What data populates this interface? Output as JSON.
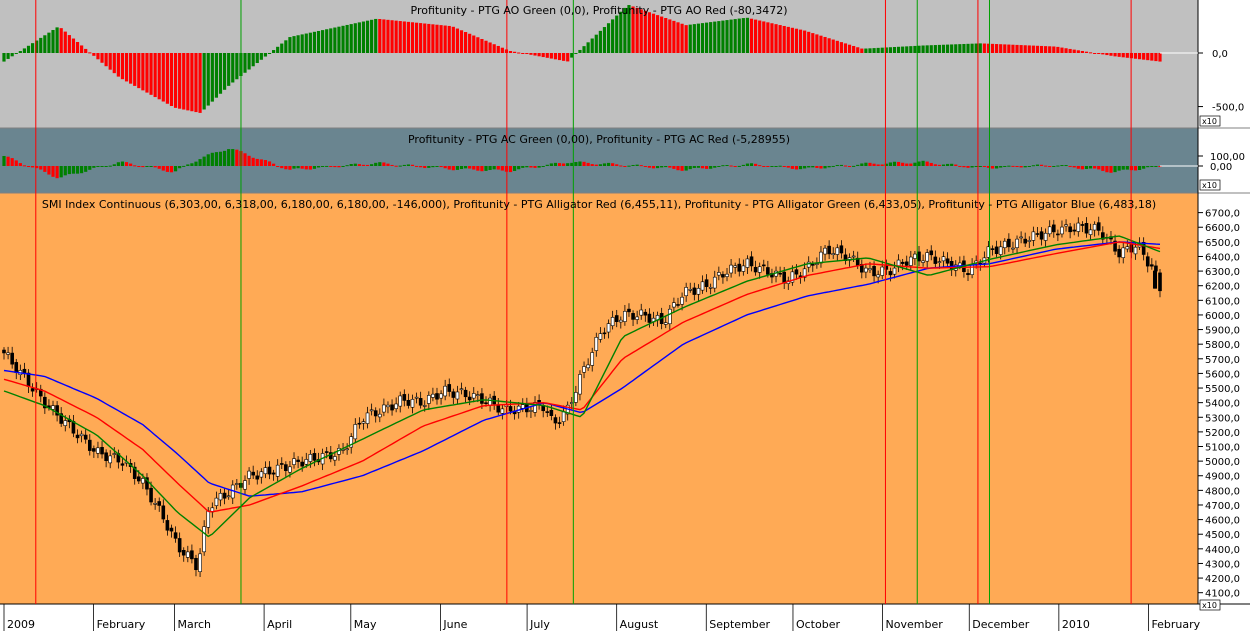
{
  "panels": {
    "ao": {
      "title": "Profitunity - PTG AO Green (0,0), Profitunity - PTG AO Red (-80,3472)",
      "ticks": [
        "0,0",
        "-500,0"
      ],
      "badge": "x10",
      "colors": {
        "background": "#c0c0c0",
        "up": "#008000",
        "down": "#ff0000"
      }
    },
    "ac": {
      "title": "Profitunity - PTG AC Green (0,00), Profitunity - PTG AC Red (-5,28955)",
      "ticks": [
        "100,00",
        "0,00"
      ],
      "badge": "x10",
      "colors": {
        "background": "#6a8590",
        "up": "#008000",
        "down": "#ff0000"
      }
    },
    "price": {
      "title": "SMI Index Continuous (6,303,00, 6,318,00, 6,180,00, 6,180,00, -146,000), Profitunity - PTG Alligator Red (6,455,11), Profitunity - PTG Alligator Green (6,433,05), Profitunity - PTG Alligator Blue (6,483,18)",
      "ticks": [
        "6700,0",
        "6600,0",
        "6500,0",
        "6400,0",
        "6300,0",
        "6200,0",
        "6100,0",
        "6000,0",
        "5900,0",
        "5800,0",
        "5700,0",
        "5600,0",
        "5500,0",
        "5400,0",
        "5300,0",
        "5200,0",
        "5100,0",
        "5000,0",
        "4900,0",
        "4800,0",
        "4700,0",
        "4600,0",
        "4500,0",
        "4400,0",
        "4300,0",
        "4200,0",
        "4100,0"
      ],
      "badge": "x10",
      "colors": {
        "background": "#ffaa55",
        "jaw": "#0000ff",
        "teeth": "#ff0000",
        "lips": "#008000",
        "up_candle": "#ffffff",
        "down_candle": "#000000"
      }
    }
  },
  "x_axis": {
    "labels": [
      "2009",
      "February",
      "March",
      "April",
      "May",
      "June",
      "July",
      "August",
      "September",
      "October",
      "November",
      "December",
      "2010",
      "February"
    ]
  },
  "chart_data": {
    "type": "line",
    "title": "SMI Index Continuous",
    "x_range": [
      "2009-01-01",
      "2010-02-05"
    ],
    "ylim": [
      4050,
      6800
    ],
    "grid": false,
    "last_bar": {
      "open": 6303,
      "high": 6318,
      "low": 6180,
      "close": 6180,
      "change": -146
    },
    "price_path": {
      "x": [
        "2009-01-01",
        "2009-01-06",
        "2009-01-15",
        "2009-01-23",
        "2009-02-02",
        "2009-02-11",
        "2009-02-18",
        "2009-02-25",
        "2009-03-02",
        "2009-03-09",
        "2009-03-13",
        "2009-03-20",
        "2009-03-27",
        "2009-04-03",
        "2009-04-14",
        "2009-04-21",
        "2009-04-28",
        "2009-05-05",
        "2009-05-12",
        "2009-05-19",
        "2009-05-26",
        "2009-06-02",
        "2009-06-09",
        "2009-06-16",
        "2009-06-23",
        "2009-06-30",
        "2009-07-07",
        "2009-07-10",
        "2009-07-15",
        "2009-07-20",
        "2009-07-27",
        "2009-08-03",
        "2009-08-10",
        "2009-08-17",
        "2009-08-24",
        "2009-09-01",
        "2009-09-08",
        "2009-09-15",
        "2009-09-22",
        "2009-09-29",
        "2009-10-06",
        "2009-10-13",
        "2009-10-20",
        "2009-10-27",
        "2009-11-03",
        "2009-11-10",
        "2009-11-17",
        "2009-11-24",
        "2009-12-01",
        "2009-12-08",
        "2009-12-15",
        "2009-12-22",
        "2009-12-31",
        "2010-01-08",
        "2010-01-15",
        "2010-01-22",
        "2010-01-28",
        "2010-02-03",
        "2010-02-05"
      ],
      "close": [
        5740,
        5620,
        5400,
        5250,
        5060,
        5000,
        4850,
        4620,
        4420,
        4280,
        4700,
        4790,
        4900,
        4930,
        5000,
        5030,
        5060,
        5300,
        5350,
        5420,
        5400,
        5480,
        5460,
        5420,
        5350,
        5360,
        5380,
        5250,
        5350,
        5600,
        5900,
        6000,
        6000,
        5950,
        6150,
        6200,
        6300,
        6350,
        6300,
        6240,
        6320,
        6450,
        6400,
        6290,
        6300,
        6380,
        6400,
        6350,
        6300,
        6440,
        6480,
        6530,
        6580,
        6600,
        6580,
        6420,
        6480,
        6303,
        6180
      ]
    },
    "series": [
      {
        "name": "Profitunity - PTG Alligator Blue",
        "x": [
          "2009-01-01",
          "2009-01-15",
          "2009-02-02",
          "2009-02-18",
          "2009-03-02",
          "2009-03-13",
          "2009-03-27",
          "2009-04-14",
          "2009-05-05",
          "2009-05-26",
          "2009-06-16",
          "2009-07-07",
          "2009-07-20",
          "2009-08-03",
          "2009-08-24",
          "2009-09-15",
          "2009-10-06",
          "2009-10-27",
          "2009-11-17",
          "2009-12-08",
          "2009-12-31",
          "2010-01-22",
          "2010-02-05"
        ],
        "y": [
          5620,
          5580,
          5430,
          5250,
          5050,
          4850,
          4760,
          4790,
          4900,
          5070,
          5280,
          5400,
          5330,
          5500,
          5800,
          6000,
          6130,
          6210,
          6320,
          6350,
          6450,
          6500,
          6483
        ]
      },
      {
        "name": "Profitunity - PTG Alligator Red",
        "x": [
          "2009-01-01",
          "2009-01-15",
          "2009-02-02",
          "2009-02-18",
          "2009-03-02",
          "2009-03-13",
          "2009-03-27",
          "2009-04-14",
          "2009-05-05",
          "2009-05-26",
          "2009-06-16",
          "2009-07-07",
          "2009-07-20",
          "2009-08-03",
          "2009-08-24",
          "2009-09-15",
          "2009-10-06",
          "2009-10-27",
          "2009-11-17",
          "2009-12-08",
          "2009-12-31",
          "2010-01-22",
          "2010-02-05"
        ],
        "y": [
          5560,
          5480,
          5300,
          5080,
          4850,
          4650,
          4700,
          4830,
          5000,
          5240,
          5380,
          5400,
          5350,
          5700,
          5950,
          6140,
          6270,
          6350,
          6320,
          6330,
          6420,
          6500,
          6455
        ]
      },
      {
        "name": "Profitunity - PTG Alligator Green",
        "x": [
          "2009-01-01",
          "2009-01-15",
          "2009-02-02",
          "2009-02-18",
          "2009-03-02",
          "2009-03-13",
          "2009-03-27",
          "2009-04-14",
          "2009-05-05",
          "2009-05-26",
          "2009-06-16",
          "2009-07-07",
          "2009-07-20",
          "2009-08-03",
          "2009-08-24",
          "2009-09-15",
          "2009-10-06",
          "2009-10-27",
          "2009-11-17",
          "2009-12-08",
          "2009-12-31",
          "2010-01-22",
          "2010-02-05"
        ],
        "y": [
          5480,
          5380,
          5180,
          4900,
          4650,
          4480,
          4750,
          4950,
          5150,
          5350,
          5420,
          5380,
          5300,
          5850,
          6050,
          6230,
          6350,
          6390,
          6270,
          6380,
          6480,
          6540,
          6433
        ]
      }
    ],
    "ao_histogram": {
      "x": [
        "2009-01-01",
        "2009-01-20",
        "2009-02-10",
        "2009-03-01",
        "2009-03-10",
        "2009-03-20",
        "2009-04-10",
        "2009-05-10",
        "2009-06-05",
        "2009-06-25",
        "2009-07-15",
        "2009-08-05",
        "2009-08-25",
        "2009-09-15",
        "2009-10-05",
        "2009-10-25",
        "2009-11-15",
        "2009-12-05",
        "2009-12-31",
        "2010-01-20",
        "2010-02-05"
      ],
      "values": [
        -80,
        250,
        -230,
        -510,
        -560,
        -300,
        150,
        320,
        250,
        20,
        -80,
        450,
        260,
        330,
        210,
        40,
        70,
        90,
        60,
        -30,
        -80
      ]
    },
    "ac_histogram": {
      "x": [
        "2009-01-01",
        "2009-01-20",
        "2009-02-10",
        "2009-03-01",
        "2009-03-10",
        "2009-03-20",
        "2009-04-10",
        "2009-05-10",
        "2009-06-05",
        "2009-06-25",
        "2009-07-15",
        "2009-08-05",
        "2009-08-25",
        "2009-09-15",
        "2009-10-05",
        "2009-10-25",
        "2009-11-15",
        "2009-12-05",
        "2009-12-31",
        "2010-01-20",
        "2010-02-05"
      ],
      "values": [
        100,
        -120,
        40,
        -60,
        80,
        180,
        -40,
        30,
        -30,
        -50,
        40,
        10,
        -40,
        20,
        -30,
        20,
        40,
        -20,
        10,
        -60,
        -5
      ]
    },
    "signal_lines": {
      "red": [
        "2009-01-12",
        "2009-06-24",
        "2009-11-02",
        "2009-12-04",
        "2010-01-26"
      ],
      "green": [
        "2009-03-24",
        "2009-07-17",
        "2009-11-13",
        "2009-12-08"
      ]
    }
  }
}
